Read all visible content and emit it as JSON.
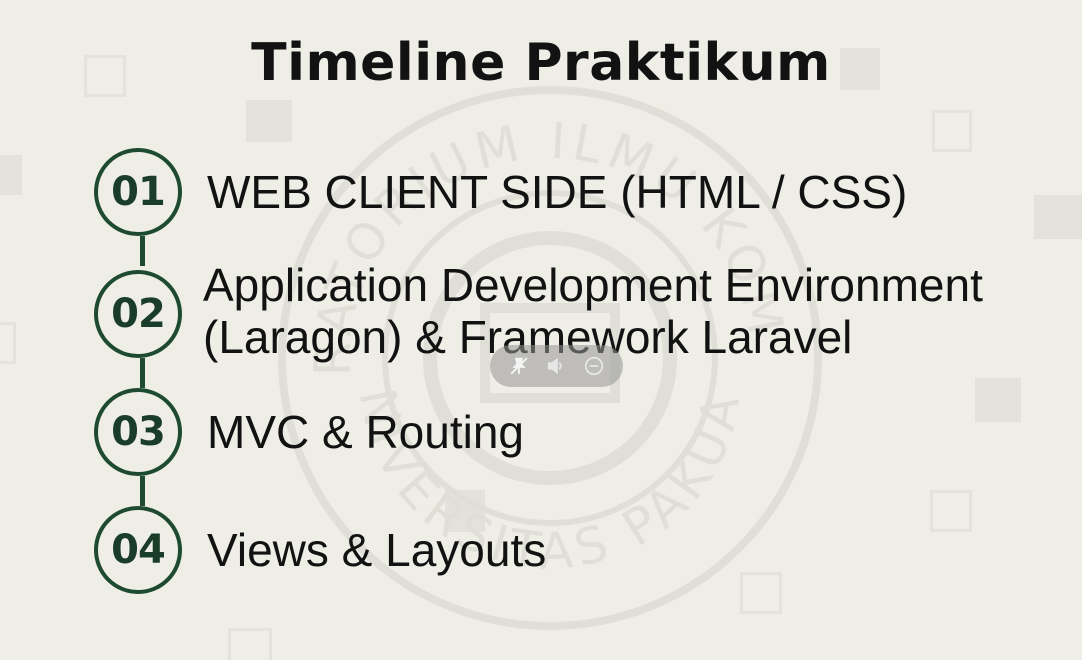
{
  "slide": {
    "title": "Timeline Praktikum",
    "items": [
      {
        "number": "01",
        "lines": [
          "WEB CLIENT SIDE (HTML / CSS)"
        ]
      },
      {
        "number": "02",
        "lines": [
          "Application Development Environment",
          "(Laragon) & Framework Laravel"
        ]
      },
      {
        "number": "03",
        "lines": [
          "MVC & Routing"
        ]
      },
      {
        "number": "04",
        "lines": [
          "Views & Layouts"
        ]
      }
    ],
    "watermark": {
      "top_text": "LABORATORIUM ILMU KOMPUTER",
      "bottom_text": "UNIVERSITAS PAKUAN"
    }
  },
  "overlay": {
    "icons": [
      "pin-off-icon",
      "volume-icon",
      "minus-circle-icon"
    ]
  },
  "colors": {
    "background": "#efeee6",
    "accent": "#1f4a32",
    "text": "#121212"
  }
}
